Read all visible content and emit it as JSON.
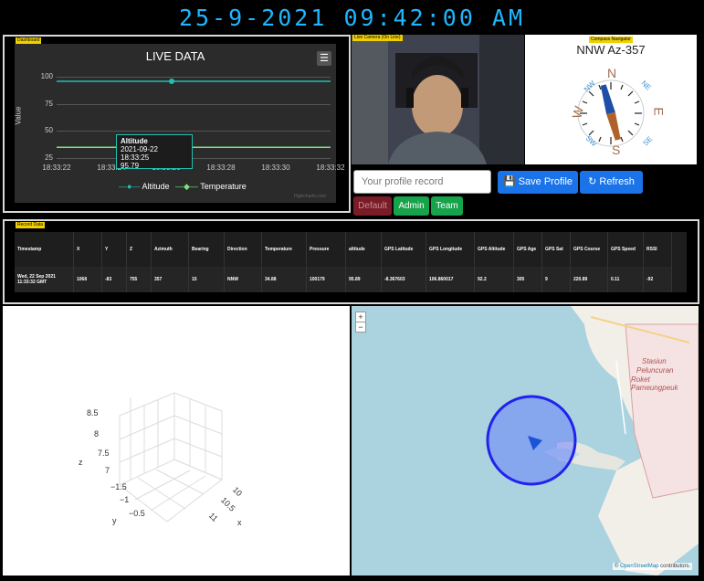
{
  "clock": "25-9-2021 09:42:00 AM",
  "dashboard": {
    "tag": "Dashboard",
    "chart_data": {
      "type": "line",
      "title": "LIVE DATA",
      "ylabel": "Value",
      "xlabel": "",
      "ylim": [
        25,
        100
      ],
      "yticks": [
        "100",
        "75",
        "50",
        "25"
      ],
      "x": [
        "18:33:22",
        "18:33:24",
        "18:33:26",
        "18:33:28",
        "18:33:30",
        "18:33:32"
      ],
      "series": [
        {
          "name": "Altitude",
          "color": "#20c0b0",
          "values": [
            95.79,
            95.79,
            95.79,
            95.79,
            95.79,
            95.79
          ]
        },
        {
          "name": "Temperature",
          "color": "#7ee07e",
          "values": [
            34.88,
            34.88,
            34.88,
            34.88,
            34.88,
            34.88
          ]
        }
      ],
      "credit": "Highcharts.com"
    },
    "tooltip": {
      "series": "Altitude",
      "time": "2021-09-22 18:33:25",
      "value": "95.79"
    },
    "menu_icon": "hamburger-icon"
  },
  "camera": {
    "tag": "Live Camera (On Line)"
  },
  "compass": {
    "tag": "Compass Navigator",
    "heading": "NNW Az-357",
    "cardinals": {
      "n": "N",
      "s": "S",
      "e": "E",
      "w": "W",
      "nw": "NW",
      "ne": "NE",
      "sw": "SW",
      "se": "SE"
    }
  },
  "controls": {
    "profile_placeholder": "Your profile record",
    "save_label": "Save Profile",
    "refresh_label": "Refresh",
    "default_label": "Default",
    "admin_label": "Admin",
    "team_label": "Team"
  },
  "records": {
    "tag": "Record Data",
    "headers": [
      "Timestamp",
      "X",
      "Y",
      "Z",
      "Azimuth",
      "Bearing",
      "Direction",
      "Temperature",
      "Pressure",
      "altitude",
      "GPS Latitude",
      "GPS Longitude",
      "GPS Altitude",
      "GPS Age",
      "GPS Sat",
      "GPS Course",
      "GPS Speed",
      "RSSI"
    ],
    "rows": [
      [
        "Wed, 22 Sep 2021 11:33:32 GMT",
        "1068",
        "-83",
        "755",
        "357",
        "15",
        "NNW",
        "34.88",
        "100179",
        "95.89",
        "-8.367603",
        "106.860017",
        "92.2",
        "305",
        "9",
        "220.89",
        "0.11",
        "-92"
      ]
    ]
  },
  "plot3d": {
    "z_label": "z",
    "x_label": "x",
    "y_label": "y",
    "z_ticks": [
      "8.5",
      "8",
      "7.5",
      "7"
    ],
    "y_ticks": [
      "−1.5",
      "−1",
      "−0.5"
    ],
    "x_ticks": [
      "10",
      "10.5",
      "11"
    ]
  },
  "map": {
    "zoom_in": "+",
    "zoom_out": "−",
    "place_label_1": "Stasiun",
    "place_label_2": "Peluncuran",
    "place_label_3": "Roket Pameungpeuk",
    "attribution_symbol": "©",
    "attribution_link": "OpenStreetMap",
    "attribution_text": "contributors."
  }
}
